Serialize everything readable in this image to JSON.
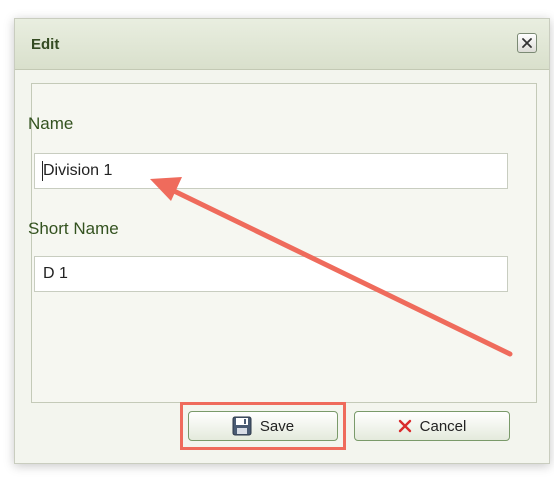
{
  "dialog": {
    "title": "Edit",
    "close_icon": "close-icon"
  },
  "form": {
    "name_label": "Name",
    "name_value": "Division 1",
    "short_name_label": "Short Name",
    "short_name_value": "D 1"
  },
  "buttons": {
    "save_label": "Save",
    "save_icon": "save-disk-icon",
    "cancel_label": "Cancel",
    "cancel_icon": "x-icon"
  },
  "annotations": {
    "arrow_color": "#ef6b5c",
    "highlight_color": "#ef6b5c"
  },
  "colors": {
    "title_text": "#344b22",
    "label_text": "#33521f",
    "cancel_x": "#d92b2b"
  }
}
